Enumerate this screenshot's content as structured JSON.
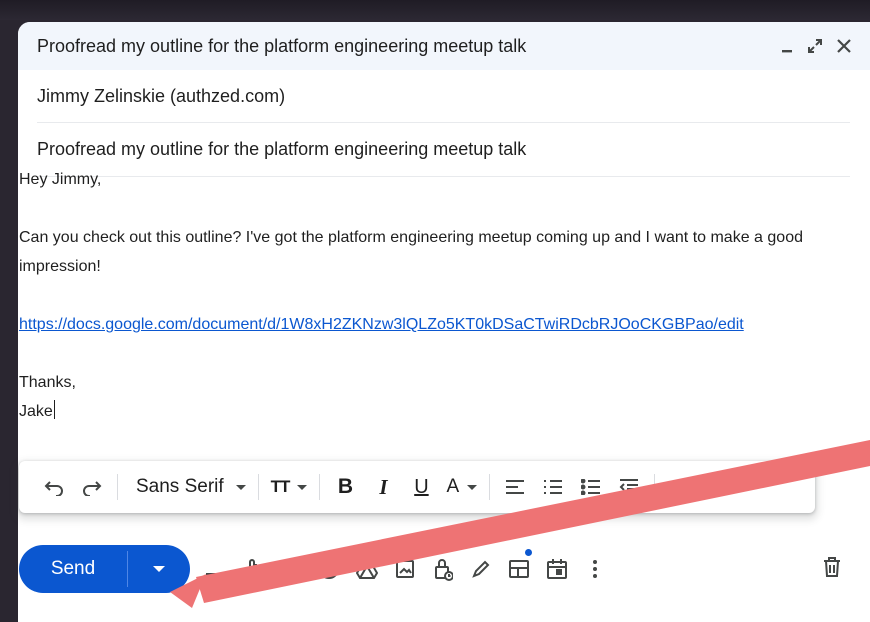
{
  "window": {
    "title": "Proofread my outline for the platform engineering meetup talk",
    "controls": {
      "minimize": "_",
      "expand": "expand",
      "close": "close"
    }
  },
  "recipient": "Jimmy Zelinskie (authzed.com)",
  "subject": "Proofread my outline for the platform engineering meetup talk",
  "body": {
    "greeting": "Hey Jimmy,",
    "paragraph": "Can you check out this outline? I've got the platform engineering meetup coming up and I want to make a good impression!",
    "link": "https://docs.google.com/document/d/1W8xH2ZKNzw3lQLZo5KT0kDSaCTwiRDcbRJOoCKGBPao/edit",
    "signoff": "Thanks,",
    "name": "Jake"
  },
  "format_toolbar": {
    "font": "Sans Serif",
    "size_icon": "TT",
    "bold": "B",
    "italic": "I",
    "underline": "U",
    "text_color": "A"
  },
  "compose_actions": {
    "send_label": "Send",
    "icons": [
      "format-icon",
      "attach-icon",
      "link-icon",
      "emoji-icon",
      "drive-icon",
      "photo-icon",
      "confidential-icon",
      "signature-icon",
      "template-icon",
      "schedule-icon",
      "more-options-icon",
      "trash-icon"
    ]
  },
  "colors": {
    "accent": "#0b57d0",
    "annotation_arrow": "#ee7374"
  }
}
